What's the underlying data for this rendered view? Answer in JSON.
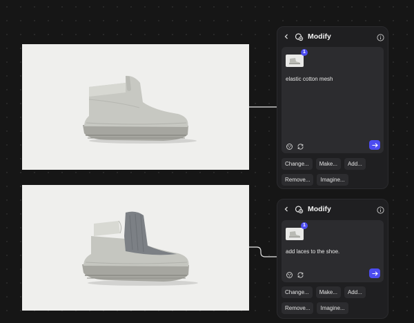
{
  "colors": {
    "background": "#161616",
    "panel": "#1f1f21",
    "field": "#2c2c2f",
    "accent": "#4c4cf0",
    "image_bg": "#efefed"
  },
  "panels": [
    {
      "title": "Modify",
      "icons": {
        "back": "chevron-left-icon",
        "mode": "modify-icon",
        "info": "info-icon"
      },
      "reference_count": "1",
      "prompt": "elastic cotton mesh",
      "tools": [
        "style-icon",
        "refresh-icon"
      ],
      "submit_icon": "arrow-right-icon",
      "suggestions": [
        "Change...",
        "Make...",
        "Add...",
        "Remove...",
        "Imagine..."
      ]
    },
    {
      "title": "Modify",
      "icons": {
        "back": "chevron-left-icon",
        "mode": "modify-icon",
        "info": "info-icon"
      },
      "reference_count": "1",
      "prompt": "add laces to the shoe.",
      "tools": [
        "style-icon",
        "refresh-icon"
      ],
      "submit_icon": "arrow-right-icon",
      "suggestions": [
        "Change...",
        "Make...",
        "Add...",
        "Remove...",
        "Imagine..."
      ]
    }
  ]
}
